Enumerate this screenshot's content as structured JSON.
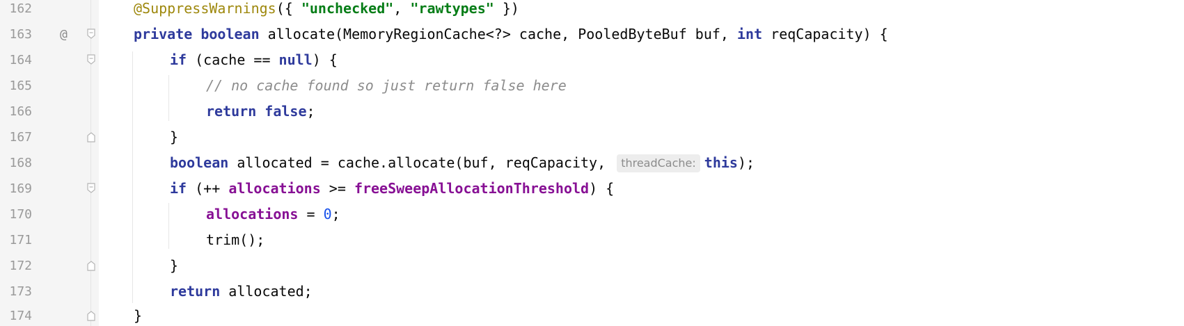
{
  "editor": {
    "line_numbers": [
      "162",
      "163",
      "164",
      "165",
      "166",
      "167",
      "168",
      "169",
      "170",
      "171",
      "172",
      "173",
      "174"
    ],
    "gutter_icon_163": "@",
    "lines": {
      "l162": {
        "annotation": "@SuppressWarnings",
        "p1": "({ ",
        "s1": "\"unchecked\"",
        "p2": ", ",
        "s2": "\"rawtypes\"",
        "p3": " })"
      },
      "l163": {
        "kw1": "private",
        "kw2": "boolean",
        "p1": " allocate(MemoryRegionCache<?> cache, PooledByteBuf buf, ",
        "kw3": "int",
        "p2": " reqCapacity) {"
      },
      "l164": {
        "kw1": "if",
        "p1": " (cache == ",
        "kw2": "null",
        "p2": ") {"
      },
      "l165": {
        "comment": "// no cache found so just return false here"
      },
      "l166": {
        "kw1": "return",
        "kw2": "false",
        "p1": ";"
      },
      "l167": {
        "p1": "}"
      },
      "l168": {
        "kw1": "boolean",
        "p1": " allocated = cache.allocate(buf, reqCapacity, ",
        "hint": "threadCache:",
        "kw2": "this",
        "p2": ");"
      },
      "l169": {
        "kw1": "if",
        "p1": " (++ ",
        "f1": "allocations",
        "p2": " >= ",
        "f2": "freeSweepAllocationThreshold",
        "p3": ") {"
      },
      "l170": {
        "f1": "allocations",
        "p1": " = ",
        "n1": "0",
        "p2": ";"
      },
      "l171": {
        "p1": "trim();"
      },
      "l172": {
        "p1": "}"
      },
      "l173": {
        "kw1": "return",
        "p1": " allocated;"
      },
      "l174": {
        "p1": "}"
      }
    }
  },
  "colors": {
    "keyword": "#2e3a9c",
    "annotation": "#9e880d",
    "string": "#067d17",
    "comment": "#8c8c8c",
    "field": "#871094",
    "number": "#1750eb",
    "gutter_bg": "#f5f5f5"
  }
}
